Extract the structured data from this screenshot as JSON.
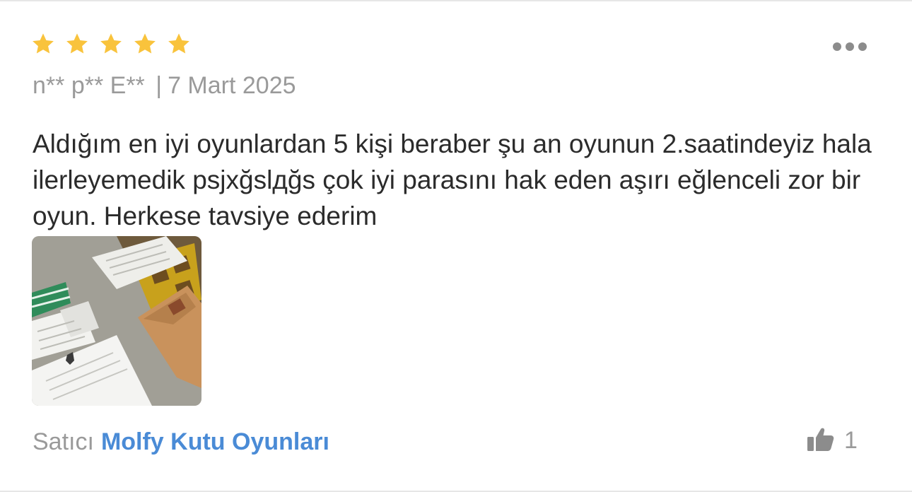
{
  "review": {
    "rating": 5,
    "max_rating": 5,
    "author": "n** p** E**",
    "separator": "|",
    "date": "7 Mart 2025",
    "comment": "Aldığım en iyi oyunlardan 5 kişi beraber şu an oyunun 2.saatindeyiz hala ilerleyemedik psjxğslдğs çok iyi parasını hak eden aşırı eğlenceli zor bir oyun. Herkese tavsiye ederim",
    "like_count": "1"
  },
  "seller": {
    "label": "Satıcı",
    "name": "Molfy Kutu Oyunları"
  },
  "icons": {
    "star": "star-icon",
    "more": "more-options-icon",
    "like": "thumbs-up-icon"
  },
  "colors": {
    "star": "#f9c33c",
    "seller_link": "#4a8bd6",
    "muted_text": "#9a9a9a",
    "body_text": "#2b2b2b"
  }
}
